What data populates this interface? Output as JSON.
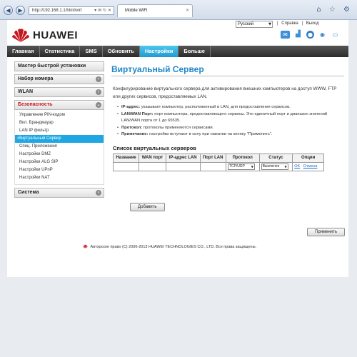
{
  "browser": {
    "address": "http://192.168.1.1/html/virt",
    "address_icons": "▾ ✉ ↻ ✕",
    "tab_title": "Mobile WiFi",
    "tab_close": "✕",
    "nav_back": "◀",
    "nav_forward": "▶",
    "toolbar_icons": "⌂ ☆ ⚙"
  },
  "header": {
    "brand": "HUAWEI",
    "language": "Русский",
    "links": [
      "Справка",
      "Выход"
    ],
    "link_separator": "|"
  },
  "menu": [
    "Главная",
    "Статистика",
    "SMS",
    "Обновить",
    "Настройки",
    "Больше"
  ],
  "menu_active": "Настройки",
  "sidebar": {
    "groups": [
      {
        "label": "Мастер быстрой установки",
        "has_toggle": false
      },
      {
        "label": "Набор номера",
        "has_toggle": true
      },
      {
        "label": "WLAN",
        "has_toggle": true
      },
      {
        "label": "Безопасность",
        "has_toggle": true
      }
    ],
    "security_items": [
      "Управление PIN-кодом",
      "Вкл. Брандмауэр",
      "LAN IP фильтр",
      "Виртуальный Сервер",
      "Спец. Приложения",
      "Настройки DMZ",
      "Настройки ALG SIP",
      "Настройки UPnP",
      "Настройки NAT"
    ],
    "active_item": "Виртуальный Сервер",
    "last_group": "Система"
  },
  "main": {
    "title": "Виртуальный Сервер",
    "intro": "Конфигурирование виртуального сервера для активирования внешних компьютеров на доступ WWW, FTP или других сервисов, предоставляемых LAN.",
    "bullets": [
      {
        "label": "IP-адрес:",
        "text": "указывает компьютер, расположенный в LAN, для предоставления сервисов."
      },
      {
        "label": "LAN/WAN Порт:",
        "text": "порт компьютера, предоставляющего сервисы. Это единичный порт и диапазон значений LAN/WAN порта от 1 до 65535."
      },
      {
        "label": "Протокол:",
        "text": "протоколы применяются сервисами."
      },
      {
        "label": "Примечание:",
        "text": "настройки вступают в силу при нажатии на кнопку \"Применить\"."
      }
    ],
    "list_title": "Список виртуальных серверов",
    "table": {
      "headers": [
        "Название",
        "WAN порт",
        "IP-адрес LAN",
        "Порт LAN",
        "Протокол",
        "Статус",
        "Опции"
      ],
      "row": {
        "protocol": "TCP/UDP",
        "status": "Выключен",
        "ok": "OK",
        "cancel": "Отмена"
      }
    },
    "add_button": "Добавить",
    "apply_button": "Применить"
  },
  "footer": {
    "copyright": "Авторское право (C) 2006-2013 HUAWEI TECHNOLOGIES CO., LTD. Все права защищены."
  },
  "colors": {
    "accent": "#1ea7e3",
    "title": "#1e86c8",
    "brand_red": "#c8161d"
  },
  "status_icons": [
    "mail-icon",
    "signal-icon",
    "globe-icon",
    "wifi-icon",
    "battery-icon"
  ]
}
